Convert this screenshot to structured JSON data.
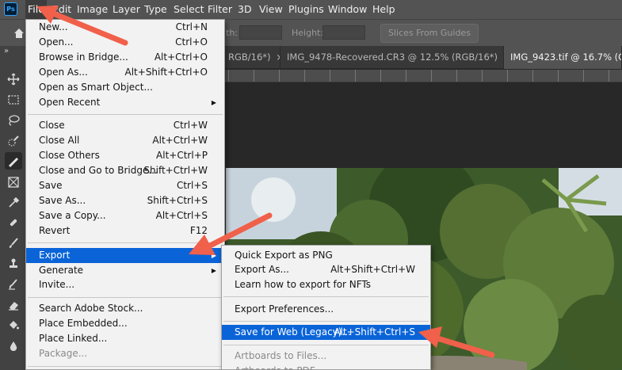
{
  "app": {
    "logo_text": "Ps"
  },
  "menubar": {
    "items": [
      "File",
      "Edit",
      "Image",
      "Layer",
      "Type",
      "Select",
      "Filter",
      "3D",
      "View",
      "Plugins",
      "Window",
      "Help"
    ],
    "active": "File"
  },
  "options": {
    "width_label": "th:",
    "height_label": "Height:",
    "slices_button": "Slices From Guides"
  },
  "tabs": [
    {
      "label": "RGB/16*)",
      "close": "×"
    },
    {
      "label": "IMG_9478-Recovered.CR3 @ 12.5% (RGB/16*)",
      "close": "×"
    },
    {
      "label": "IMG_9423.tif @ 16.7% (Clic",
      "close": ""
    }
  ],
  "toolbar": {
    "collapse": "»",
    "tools": [
      "move-tool",
      "marquee-tool",
      "lasso-tool",
      "quick-selection-tool",
      "slice-tool",
      "frame-tool",
      "eyedropper-tool",
      "healing-brush-tool",
      "brush-tool",
      "clone-stamp-tool",
      "history-brush-tool",
      "eraser-tool",
      "paint-bucket-tool",
      "blur-tool"
    ]
  },
  "canvas": {
    "partial_label": "8"
  },
  "file_menu": {
    "groups": [
      [
        {
          "label": "New...",
          "shortcut": "Ctrl+N"
        },
        {
          "label": "Open...",
          "shortcut": "Ctrl+O"
        },
        {
          "label": "Browse in Bridge...",
          "shortcut": "Alt+Ctrl+O"
        },
        {
          "label": "Open As...",
          "shortcut": "Alt+Shift+Ctrl+O"
        },
        {
          "label": "Open as Smart Object...",
          "shortcut": ""
        },
        {
          "label": "Open Recent",
          "shortcut": "",
          "submenu": true
        }
      ],
      [
        {
          "label": "Close",
          "shortcut": "Ctrl+W"
        },
        {
          "label": "Close All",
          "shortcut": "Alt+Ctrl+W"
        },
        {
          "label": "Close Others",
          "shortcut": "Alt+Ctrl+P"
        },
        {
          "label": "Close and Go to Bridge...",
          "shortcut": "Shift+Ctrl+W"
        },
        {
          "label": "Save",
          "shortcut": "Ctrl+S"
        },
        {
          "label": "Save As...",
          "shortcut": "Shift+Ctrl+S"
        },
        {
          "label": "Save a Copy...",
          "shortcut": "Alt+Ctrl+S"
        },
        {
          "label": "Revert",
          "shortcut": "F12"
        }
      ],
      [
        {
          "label": "Export",
          "shortcut": "",
          "submenu": true,
          "highlighted": true
        },
        {
          "label": "Generate",
          "shortcut": "",
          "submenu": true
        },
        {
          "label": "Invite...",
          "shortcut": ""
        }
      ],
      [
        {
          "label": "Search Adobe Stock...",
          "shortcut": ""
        },
        {
          "label": "Place Embedded...",
          "shortcut": ""
        },
        {
          "label": "Place Linked...",
          "shortcut": ""
        },
        {
          "label": "Package...",
          "shortcut": "",
          "disabled": true
        }
      ]
    ]
  },
  "export_menu": {
    "groups": [
      [
        {
          "label": "Quick Export as PNG",
          "shortcut": ""
        },
        {
          "label": "Export As...",
          "shortcut": "Alt+Shift+Ctrl+W"
        },
        {
          "label": "Learn how to export for NFTs",
          "shortcut": ""
        }
      ],
      [
        {
          "label": "Export Preferences...",
          "shortcut": ""
        }
      ],
      [
        {
          "label": "Save for Web (Legacy)...",
          "shortcut": "Alt+Shift+Ctrl+S",
          "highlighted": true
        }
      ],
      [
        {
          "label": "Artboards to Files...",
          "shortcut": "",
          "disabled": true
        },
        {
          "label": "Artboards to PDF...",
          "shortcut": "",
          "disabled": true
        }
      ]
    ]
  },
  "colors": {
    "highlight": "#0a64d8",
    "annotation_arrow": "#f0604a",
    "menu_bg": "#f2f2f2"
  }
}
